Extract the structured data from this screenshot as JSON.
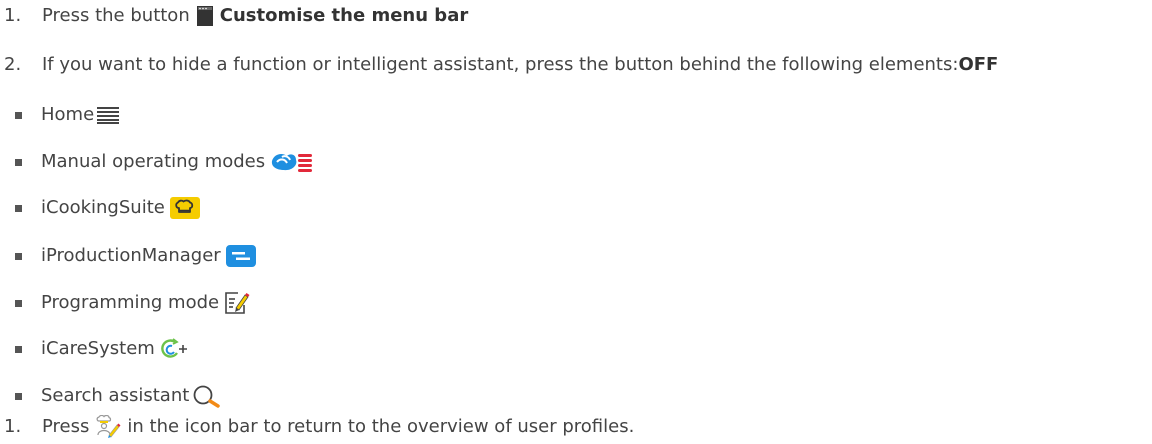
{
  "steps_first": [
    {
      "number": "1.",
      "text_before": "Press the button",
      "icon": "oven-menu-icon",
      "bold_text": "Customise the menu bar"
    },
    {
      "number": "2.",
      "text": "If you want to hide a function or intelligent assistant, press the button behind the following elements:",
      "bold_text": "OFF"
    }
  ],
  "elements": [
    {
      "label": "Home",
      "icon": "home-menu-icon"
    },
    {
      "label": "Manual operating modes",
      "icon": "manual-modes-icon"
    },
    {
      "label": "iCookingSuite",
      "icon": "icookingsuite-icon"
    },
    {
      "label": "iProductionManager",
      "icon": "iproductionmanager-icon"
    },
    {
      "label": "Programming mode",
      "icon": "programming-mode-icon"
    },
    {
      "label": "iCareSystem",
      "icon": "icaresystem-icon"
    },
    {
      "label": "Search assistant",
      "icon": "search-icon"
    }
  ],
  "step_last": {
    "number": "1.",
    "text_before": "Press",
    "icon": "user-profile-icon",
    "text_after": "in the icon bar to return to the overview of user profiles."
  },
  "colors": {
    "text": "#444444",
    "blue": "#1f8fe0",
    "red": "#e2293a",
    "yellow": "#f5cc00",
    "orange": "#f28a16",
    "green": "#6cc24a"
  }
}
